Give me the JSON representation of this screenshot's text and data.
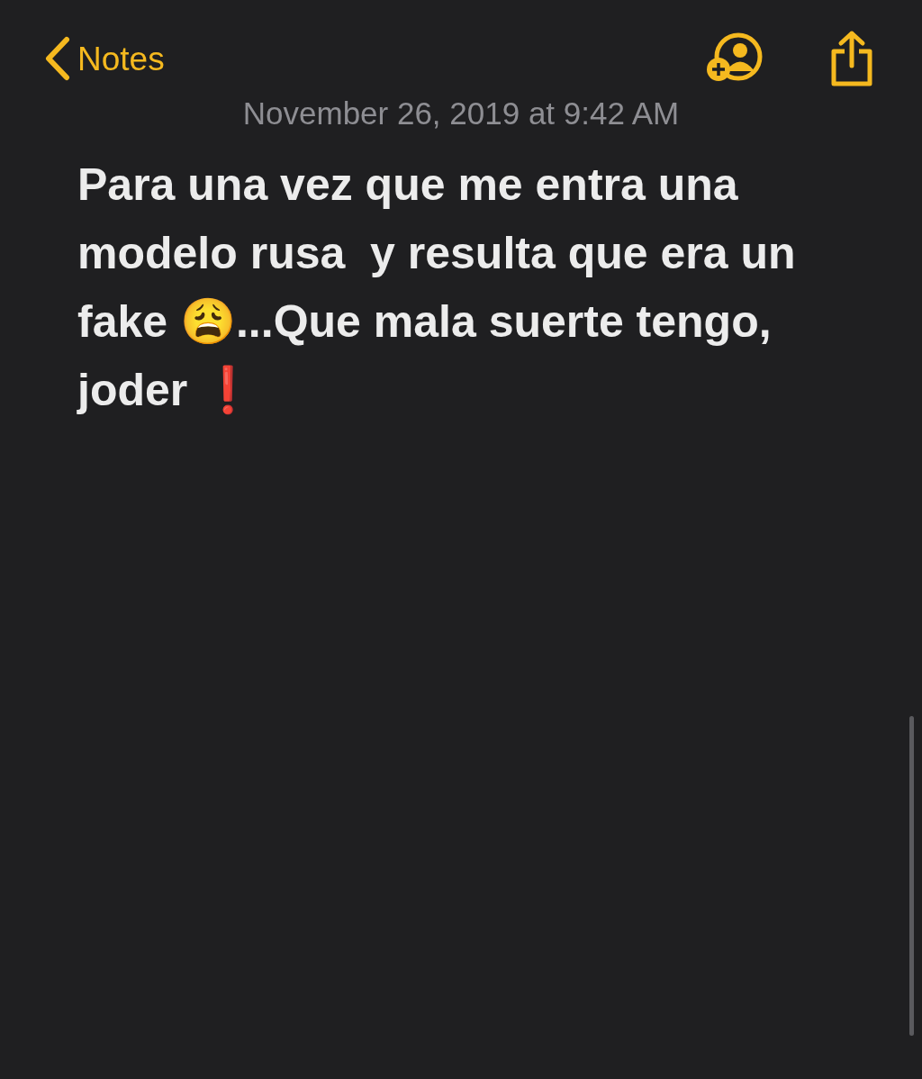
{
  "nav_bar": {
    "back_label": "Notes"
  },
  "note": {
    "date": "November 26, 2019 at 9:42 AM",
    "body": "Para una vez que me entra una modelo rusa  y resulta que era un fake 😩...Que mala suerte tengo, joder ❗"
  }
}
